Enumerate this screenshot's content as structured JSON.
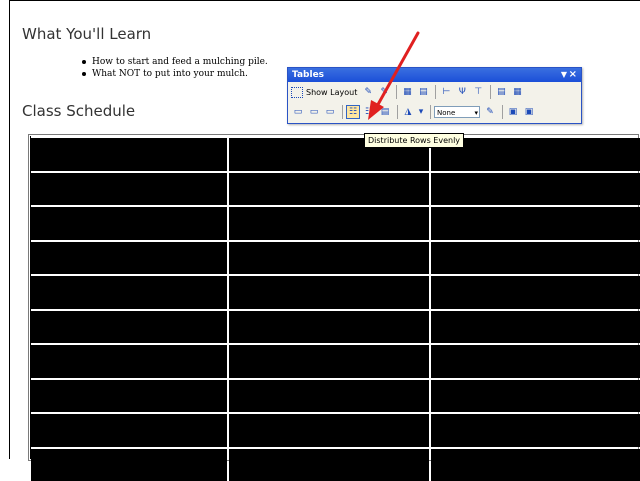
{
  "headings": {
    "learn": "What You'll Learn",
    "schedule": "Class Schedule"
  },
  "bullets": [
    "How to start and feed a mulching pile.",
    "What NOT to put into your mulch."
  ],
  "toolbar": {
    "title": "Tables",
    "show_layout_label": "Show Layout",
    "menu_glyph": "▼",
    "close_glyph": "×",
    "border_select_value": "None"
  },
  "tooltip": {
    "text": "Distribute Rows Evenly"
  },
  "table": {
    "rows": 10,
    "columns": 3
  },
  "colors": {
    "titlebar": "#1b4fd8",
    "highlight": "#ffe6a0",
    "arrow": "#e02020"
  }
}
